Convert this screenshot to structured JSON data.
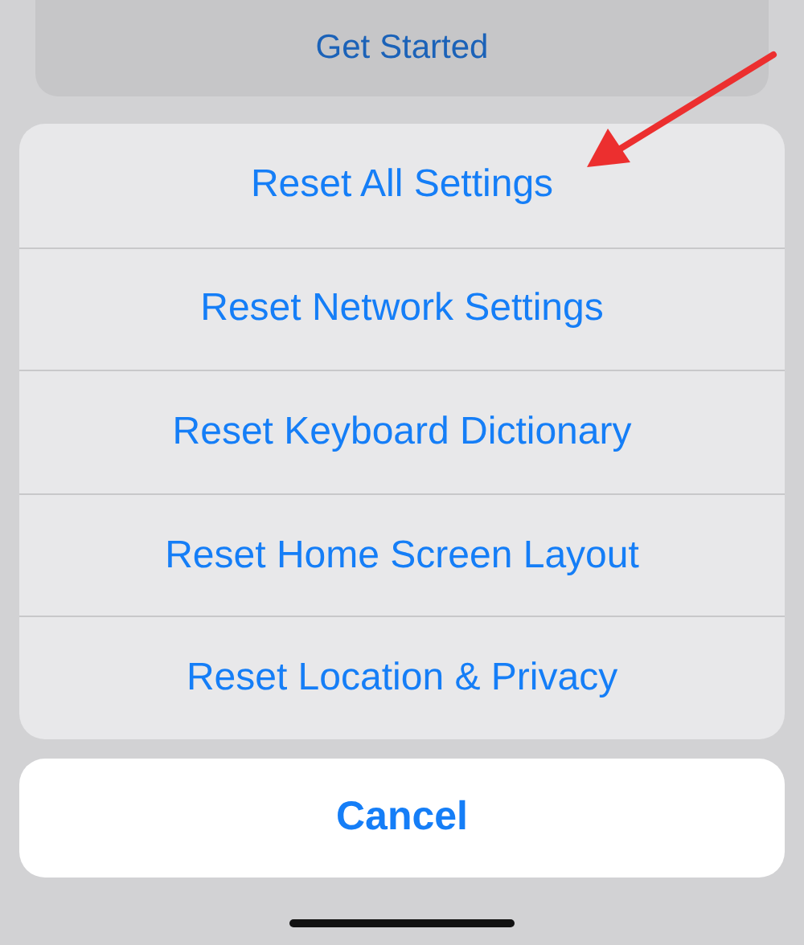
{
  "background_button": {
    "label": "Get Started"
  },
  "action_sheet": {
    "actions": [
      {
        "label": "Reset All Settings"
      },
      {
        "label": "Reset Network Settings"
      },
      {
        "label": "Reset Keyboard Dictionary"
      },
      {
        "label": "Reset Home Screen Layout"
      },
      {
        "label": "Reset Location & Privacy"
      }
    ]
  },
  "cancel_button": {
    "label": "Cancel"
  }
}
